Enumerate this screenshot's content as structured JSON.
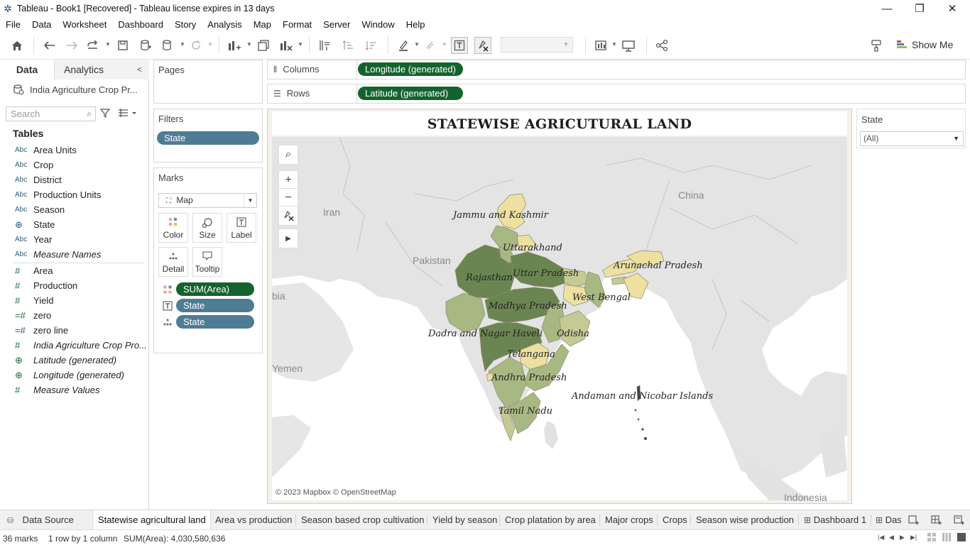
{
  "window": {
    "title": "Tableau - Book1 [Recovered] - Tableau license expires in 13 days",
    "minimize": "—",
    "restore": "❐",
    "close": "✕"
  },
  "menu": [
    "File",
    "Data",
    "Worksheet",
    "Dashboard",
    "Story",
    "Analysis",
    "Map",
    "Format",
    "Server",
    "Window",
    "Help"
  ],
  "toolbar": {
    "show_me_label": "Show Me"
  },
  "data_pane": {
    "tabs": {
      "data": "Data",
      "analytics": "Analytics"
    },
    "data_source": "India Agriculture Crop Pr...",
    "search_placeholder": "Search",
    "tables_heading": "Tables",
    "dimensions": [
      {
        "type": "Abc",
        "name": "Area Units"
      },
      {
        "type": "Abc",
        "name": "Crop"
      },
      {
        "type": "Abc",
        "name": "District"
      },
      {
        "type": "Abc",
        "name": "Production Units"
      },
      {
        "type": "Abc",
        "name": "Season"
      },
      {
        "type": "globe",
        "name": "State"
      },
      {
        "type": "Abc",
        "name": "Year"
      },
      {
        "type": "Abc",
        "name": "Measure Names"
      }
    ],
    "measures": [
      {
        "type": "#",
        "name": "Area"
      },
      {
        "type": "#",
        "name": "Production"
      },
      {
        "type": "#",
        "name": "Yield"
      },
      {
        "type": "#=",
        "name": "zero"
      },
      {
        "type": "#=",
        "name": "zero line"
      },
      {
        "type": "#",
        "name": "India Agriculture Crop Pro..."
      },
      {
        "type": "globe",
        "name": "Latitude (generated)"
      },
      {
        "type": "globe",
        "name": "Longitude (generated)"
      },
      {
        "type": "#",
        "name": "Measure Values"
      }
    ]
  },
  "pages": {
    "title": "Pages"
  },
  "filters": {
    "title": "Filters",
    "pills": [
      "State"
    ]
  },
  "marks": {
    "title": "Marks",
    "mark_type": "Map",
    "buttons": {
      "color": "Color",
      "size": "Size",
      "label": "Label",
      "detail": "Detail",
      "tooltip": "Tooltip"
    },
    "pills": [
      "SUM(Area)",
      "State",
      "State"
    ]
  },
  "shelves": {
    "columns_label": "Columns",
    "columns_pill": "Longitude (generated)",
    "rows_label": "Rows",
    "rows_pill": "Latitude (generated)"
  },
  "view": {
    "title": "STATEWISE AGRICUTURAL LAND",
    "countries": {
      "iran": "Iran",
      "pakistan": "Pakistan",
      "china": "China",
      "yemen": "Yemen",
      "indonesia": "Indonesia",
      "somalia": "bia"
    },
    "state_labels": {
      "jk": "Jammu and Kashmir",
      "uk": "Uttarakhand",
      "rj": "Rajasthan",
      "up": "Uttar Pradesh",
      "ar": "Arunachal Pradesh",
      "mp": "Madhya Pradesh",
      "wb": "West Bengal",
      "dn": "Dadra and Nagar Haveli",
      "od": "Odisha",
      "tg": "Telangana",
      "ap": "Andhra Pradesh",
      "an": "Andaman and Nicobar Islands",
      "tn": "Tamil Nadu"
    },
    "attribution": "© 2023 Mapbox © OpenStreetMap",
    "colors": {
      "dark": "#6b8552",
      "mid": "#a8b882",
      "light": "#c5c994",
      "pale": "#ede0a0"
    }
  },
  "state_filter": {
    "title": "State",
    "value": "(All)"
  },
  "sheet_tabs": {
    "data_source": "Data Source",
    "tabs": [
      "Statewise agricultural land",
      "Area vs production",
      "Season based crop cultivation",
      "Yield by season",
      "Crop platation by area",
      "Major crops",
      "Crops",
      "Season wise production",
      "Dashboard 1",
      "Das"
    ]
  },
  "status": {
    "marks": "36 marks",
    "rows_cols": "1 row by 1 column",
    "sum": "SUM(Area): 4,030,580,636"
  }
}
